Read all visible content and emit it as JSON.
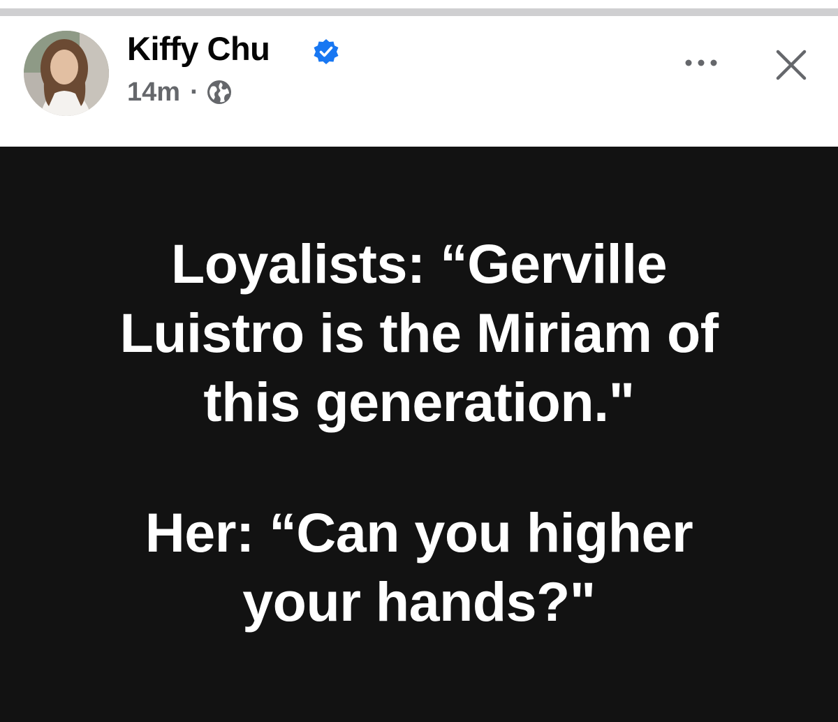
{
  "post": {
    "author": "Kiffy Chu",
    "time": "14m",
    "separator": "·",
    "privacy_icon": "globe-icon",
    "verified_icon": "verified-badge-icon",
    "more_icon": "more-options-icon",
    "close_icon": "close-icon",
    "text_lines_1": [
      "Loyalists: “Gerville",
      "Luistro is the Miriam of",
      "this generation.\""
    ],
    "text_lines_2": [
      "Her: “Can you higher",
      "your hands?\""
    ]
  },
  "colors": {
    "post_background": "#121212",
    "verified_blue": "#1877f2",
    "meta_gray": "#65676b"
  }
}
